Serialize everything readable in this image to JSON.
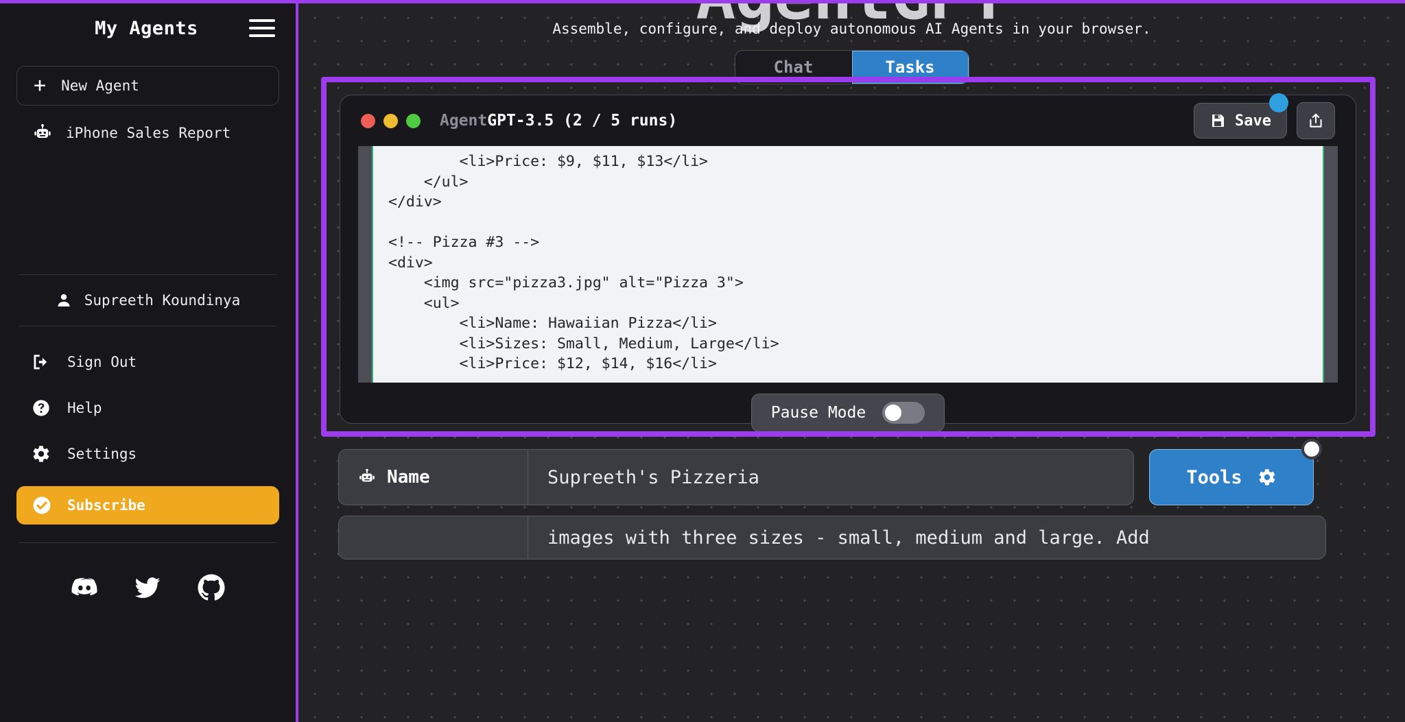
{
  "top_rule_color": "#9d3ced",
  "sidebar": {
    "title": "My Agents",
    "menu_icon": "hamburger-icon",
    "new_agent_label": "New Agent",
    "agents": [
      {
        "label": "iPhone Sales Report",
        "icon": "robot-icon"
      }
    ],
    "user": {
      "name": "Supreeth Koundinya",
      "icon": "user-icon"
    },
    "menu": [
      {
        "label": "Sign Out",
        "icon": "sign-out-icon"
      },
      {
        "label": "Help",
        "icon": "help-circle-icon"
      },
      {
        "label": "Settings",
        "icon": "gear-icon"
      }
    ],
    "subscribe": {
      "label": "Subscribe",
      "icon": "check-circle-icon",
      "color": "#f0a81e"
    },
    "socials": [
      {
        "name": "discord-icon"
      },
      {
        "name": "twitter-icon"
      },
      {
        "name": "github-icon"
      }
    ]
  },
  "main": {
    "hero_title": "AgentGPT",
    "hero_subtitle": "Assemble, configure, and deploy autonomous AI Agents in your browser.",
    "tabs": [
      {
        "label": "Chat",
        "active": false
      },
      {
        "label": "Tasks",
        "active": true
      }
    ],
    "accent_blue": "#2e80c9",
    "highlight_color": "#9d3ced"
  },
  "agent_window": {
    "title_dim": "Agent",
    "title_bright": "GPT-3.5 (2 / 5 runs)",
    "runs_current": 2,
    "runs_total": 5,
    "traffic_lights": [
      "#ec5e56",
      "#f0bc2f",
      "#4fc93f"
    ],
    "save_label": "Save",
    "save_icon": "floppy-disk-icon",
    "share_icon": "share-upload-icon",
    "badge_color": "#2f9fe0",
    "code_lines": "        <li>Price: $9, $11, $13</li>\n    </ul>\n</div>\n\n<!-- Pizza #3 -->\n<div>\n    <img src=\"pizza3.jpg\" alt=\"Pizza 3\">\n    <ul>\n        <li>Name: Hawaiian Pizza</li>\n        <li>Sizes: Small, Medium, Large</li>\n        <li>Price: $12, $14, $16</li>",
    "pause_label": "Pause Mode",
    "pause_enabled": false
  },
  "form": {
    "name_label": "Name",
    "name_icon": "robot-icon",
    "name_value": "Supreeth's Pizzeria",
    "tools_label": "Tools",
    "tools_icon": "gear-icon",
    "prompt_value": "images with three sizes - small, medium and large. Add"
  }
}
